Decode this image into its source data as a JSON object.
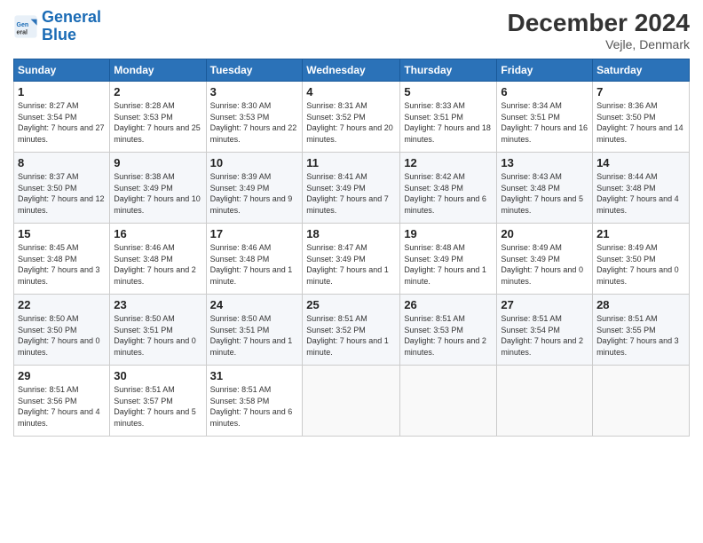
{
  "logo": {
    "line1": "General",
    "line2": "Blue"
  },
  "title": "December 2024",
  "location": "Vejle, Denmark",
  "weekdays": [
    "Sunday",
    "Monday",
    "Tuesday",
    "Wednesday",
    "Thursday",
    "Friday",
    "Saturday"
  ],
  "weeks": [
    [
      {
        "day": "1",
        "sunrise": "Sunrise: 8:27 AM",
        "sunset": "Sunset: 3:54 PM",
        "daylight": "Daylight: 7 hours and 27 minutes."
      },
      {
        "day": "2",
        "sunrise": "Sunrise: 8:28 AM",
        "sunset": "Sunset: 3:53 PM",
        "daylight": "Daylight: 7 hours and 25 minutes."
      },
      {
        "day": "3",
        "sunrise": "Sunrise: 8:30 AM",
        "sunset": "Sunset: 3:53 PM",
        "daylight": "Daylight: 7 hours and 22 minutes."
      },
      {
        "day": "4",
        "sunrise": "Sunrise: 8:31 AM",
        "sunset": "Sunset: 3:52 PM",
        "daylight": "Daylight: 7 hours and 20 minutes."
      },
      {
        "day": "5",
        "sunrise": "Sunrise: 8:33 AM",
        "sunset": "Sunset: 3:51 PM",
        "daylight": "Daylight: 7 hours and 18 minutes."
      },
      {
        "day": "6",
        "sunrise": "Sunrise: 8:34 AM",
        "sunset": "Sunset: 3:51 PM",
        "daylight": "Daylight: 7 hours and 16 minutes."
      },
      {
        "day": "7",
        "sunrise": "Sunrise: 8:36 AM",
        "sunset": "Sunset: 3:50 PM",
        "daylight": "Daylight: 7 hours and 14 minutes."
      }
    ],
    [
      {
        "day": "8",
        "sunrise": "Sunrise: 8:37 AM",
        "sunset": "Sunset: 3:50 PM",
        "daylight": "Daylight: 7 hours and 12 minutes."
      },
      {
        "day": "9",
        "sunrise": "Sunrise: 8:38 AM",
        "sunset": "Sunset: 3:49 PM",
        "daylight": "Daylight: 7 hours and 10 minutes."
      },
      {
        "day": "10",
        "sunrise": "Sunrise: 8:39 AM",
        "sunset": "Sunset: 3:49 PM",
        "daylight": "Daylight: 7 hours and 9 minutes."
      },
      {
        "day": "11",
        "sunrise": "Sunrise: 8:41 AM",
        "sunset": "Sunset: 3:49 PM",
        "daylight": "Daylight: 7 hours and 7 minutes."
      },
      {
        "day": "12",
        "sunrise": "Sunrise: 8:42 AM",
        "sunset": "Sunset: 3:48 PM",
        "daylight": "Daylight: 7 hours and 6 minutes."
      },
      {
        "day": "13",
        "sunrise": "Sunrise: 8:43 AM",
        "sunset": "Sunset: 3:48 PM",
        "daylight": "Daylight: 7 hours and 5 minutes."
      },
      {
        "day": "14",
        "sunrise": "Sunrise: 8:44 AM",
        "sunset": "Sunset: 3:48 PM",
        "daylight": "Daylight: 7 hours and 4 minutes."
      }
    ],
    [
      {
        "day": "15",
        "sunrise": "Sunrise: 8:45 AM",
        "sunset": "Sunset: 3:48 PM",
        "daylight": "Daylight: 7 hours and 3 minutes."
      },
      {
        "day": "16",
        "sunrise": "Sunrise: 8:46 AM",
        "sunset": "Sunset: 3:48 PM",
        "daylight": "Daylight: 7 hours and 2 minutes."
      },
      {
        "day": "17",
        "sunrise": "Sunrise: 8:46 AM",
        "sunset": "Sunset: 3:48 PM",
        "daylight": "Daylight: 7 hours and 1 minute."
      },
      {
        "day": "18",
        "sunrise": "Sunrise: 8:47 AM",
        "sunset": "Sunset: 3:49 PM",
        "daylight": "Daylight: 7 hours and 1 minute."
      },
      {
        "day": "19",
        "sunrise": "Sunrise: 8:48 AM",
        "sunset": "Sunset: 3:49 PM",
        "daylight": "Daylight: 7 hours and 1 minute."
      },
      {
        "day": "20",
        "sunrise": "Sunrise: 8:49 AM",
        "sunset": "Sunset: 3:49 PM",
        "daylight": "Daylight: 7 hours and 0 minutes."
      },
      {
        "day": "21",
        "sunrise": "Sunrise: 8:49 AM",
        "sunset": "Sunset: 3:50 PM",
        "daylight": "Daylight: 7 hours and 0 minutes."
      }
    ],
    [
      {
        "day": "22",
        "sunrise": "Sunrise: 8:50 AM",
        "sunset": "Sunset: 3:50 PM",
        "daylight": "Daylight: 7 hours and 0 minutes."
      },
      {
        "day": "23",
        "sunrise": "Sunrise: 8:50 AM",
        "sunset": "Sunset: 3:51 PM",
        "daylight": "Daylight: 7 hours and 0 minutes."
      },
      {
        "day": "24",
        "sunrise": "Sunrise: 8:50 AM",
        "sunset": "Sunset: 3:51 PM",
        "daylight": "Daylight: 7 hours and 1 minute."
      },
      {
        "day": "25",
        "sunrise": "Sunrise: 8:51 AM",
        "sunset": "Sunset: 3:52 PM",
        "daylight": "Daylight: 7 hours and 1 minute."
      },
      {
        "day": "26",
        "sunrise": "Sunrise: 8:51 AM",
        "sunset": "Sunset: 3:53 PM",
        "daylight": "Daylight: 7 hours and 2 minutes."
      },
      {
        "day": "27",
        "sunrise": "Sunrise: 8:51 AM",
        "sunset": "Sunset: 3:54 PM",
        "daylight": "Daylight: 7 hours and 2 minutes."
      },
      {
        "day": "28",
        "sunrise": "Sunrise: 8:51 AM",
        "sunset": "Sunset: 3:55 PM",
        "daylight": "Daylight: 7 hours and 3 minutes."
      }
    ],
    [
      {
        "day": "29",
        "sunrise": "Sunrise: 8:51 AM",
        "sunset": "Sunset: 3:56 PM",
        "daylight": "Daylight: 7 hours and 4 minutes."
      },
      {
        "day": "30",
        "sunrise": "Sunrise: 8:51 AM",
        "sunset": "Sunset: 3:57 PM",
        "daylight": "Daylight: 7 hours and 5 minutes."
      },
      {
        "day": "31",
        "sunrise": "Sunrise: 8:51 AM",
        "sunset": "Sunset: 3:58 PM",
        "daylight": "Daylight: 7 hours and 6 minutes."
      },
      null,
      null,
      null,
      null
    ]
  ]
}
